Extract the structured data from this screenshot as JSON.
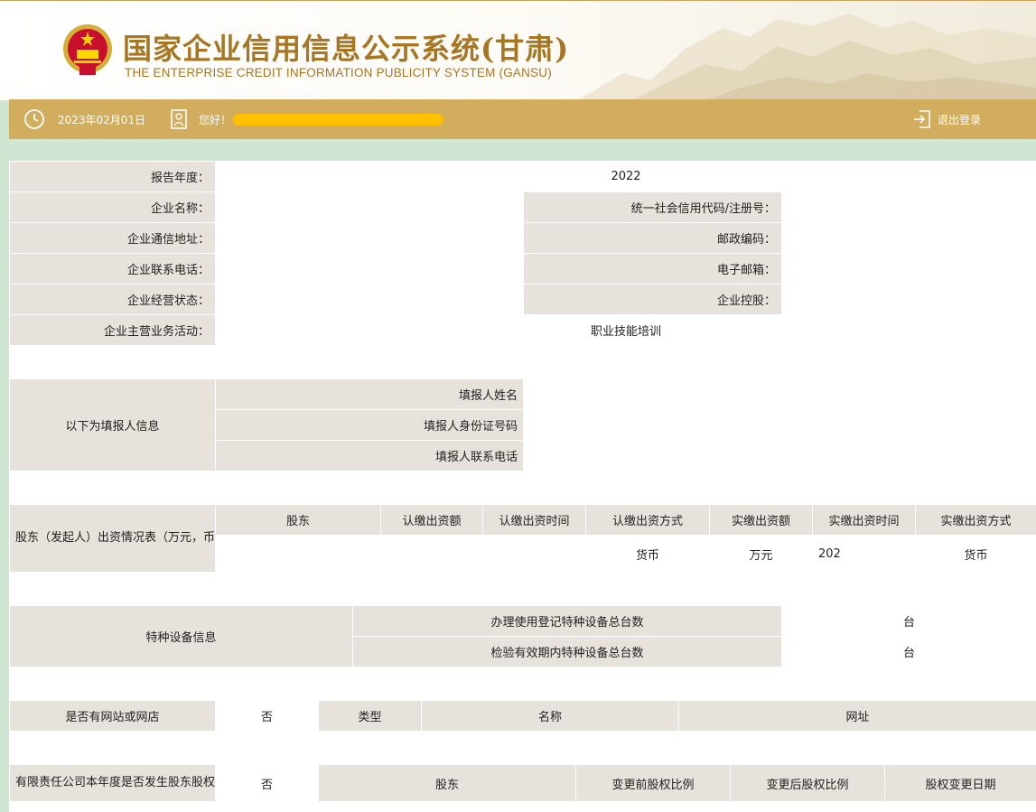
{
  "header": {
    "title": "国家企业信用信息公示系统(甘肃)",
    "subtitle": "THE ENTERPRISE CREDIT INFORMATION PUBLICITY SYSTEM (GANSU)",
    "colors": {
      "title": "#a77622",
      "bar": "#d2ad5e",
      "page_bg": "#cfe6d3",
      "label_bg": "#e8e2dc"
    }
  },
  "topbar": {
    "date": "2023年02月01日",
    "greeting": "您好！",
    "user_name": "",
    "logout": "退出登录",
    "icons": [
      "clock-icon",
      "user-icon",
      "logout-icon"
    ]
  },
  "report": {
    "year_label": "报告年度：",
    "year": "2022",
    "name_label": "企业名称：",
    "name": "",
    "credit_code_label": "统一社会信用代码/注册号：",
    "credit_code": "",
    "address_label": "企业通信地址：",
    "address": "",
    "postcode_label": "邮政编码：",
    "postcode": "",
    "phone_label": "企业联系电话：",
    "phone": "",
    "email_label": "电子邮箱：",
    "email": "",
    "status_label": "企业经营状态：",
    "status": "",
    "holding_label": "企业控股：",
    "holding": "",
    "business_label": "企业主营业务活动：",
    "business": "职业技能培训"
  },
  "filler": {
    "section_label": "以下为填报人信息",
    "name_label": "填报人姓名",
    "name": "",
    "id_label": "填报人身份证号码",
    "id": "",
    "phone_label": "填报人联系电话",
    "phone": ""
  },
  "shareholders": {
    "section_label": "股东（发起人）出资情况表（万元，币种应与注册资本币种一致）",
    "headers": [
      "股东",
      "认缴出资额",
      "认缴出资时间",
      "认缴出资方式",
      "实缴出资额",
      "实缴出资时间",
      "实缴出资方式"
    ],
    "rows": [
      [
        "",
        "",
        "",
        "货币",
        "万元",
        "202",
        "货币"
      ]
    ]
  },
  "equipment": {
    "section_label": "特种设备信息",
    "registered_label": "办理使用登记特种设备总台数",
    "registered_unit": "台",
    "inspected_label": "检验有效期内特种设备总台数",
    "inspected_unit": "台"
  },
  "website": {
    "question": "是否有网站或网店",
    "answer": "否",
    "headers": [
      "类型",
      "名称",
      "网址"
    ]
  },
  "equity_transfer": {
    "question": "有限责任公司本年度是否发生股东股权转让",
    "answer": "否",
    "headers": [
      "股东",
      "变更前股权比例",
      "变更后股权比例",
      "股权变更日期"
    ]
  }
}
